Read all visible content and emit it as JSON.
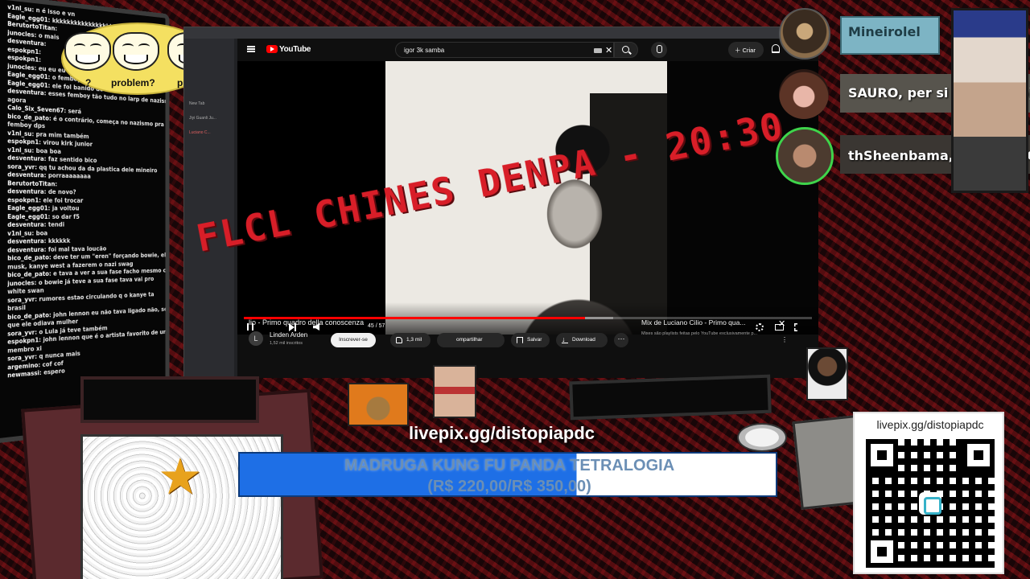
{
  "chat": {
    "lines": [
      {
        "user": "v1nl_su",
        "text": "n é isso e vn"
      },
      {
        "user": "Eagle_egg01",
        "text": "kkkkkkkkkkkkkkkkkkkk"
      },
      {
        "user": "BerutortoTitan",
        "text": ""
      },
      {
        "user": "junocles",
        "text": "o mais"
      },
      {
        "user": "desventura",
        "text": ""
      },
      {
        "user": "espokpn1",
        "text": ""
      },
      {
        "user": "espokpn1",
        "text": ""
      },
      {
        "user": "junocles",
        "text": "eu eu eu"
      },
      {
        "user": "Eagle_egg01",
        "text": "o femboy q quase vazou nuds na dm?"
      },
      {
        "user": "Eagle_egg01",
        "text": "ele fol banido do server"
      },
      {
        "user": "desventura",
        "text": "esses femboy tão tudo no larp de nazismo"
      },
      {
        "user": "",
        "text": "agora"
      },
      {
        "user": "Calo_Six_Seven67",
        "text": "será"
      },
      {
        "user": "bico_de_pato",
        "text": "é o contrário, começa no nazismo pra virar"
      },
      {
        "user": "",
        "text": "femboy dps"
      },
      {
        "user": "v1nl_su",
        "text": "pra mim também"
      },
      {
        "user": "espokpn1",
        "text": "virou kirk junior"
      },
      {
        "user": "v1nl_su",
        "text": "boa boa"
      },
      {
        "user": "desventura",
        "text": "faz sentido bico"
      },
      {
        "user": "sora_yvr",
        "text": "qq tu achou da da plastica dele mineiro"
      },
      {
        "user": "desventura",
        "text": "porraaaaaaaa"
      },
      {
        "user": "BerutortoTitan",
        "text": ""
      },
      {
        "user": "desventura",
        "text": "de novo?"
      },
      {
        "user": "espokpn1",
        "text": "ele foi trocar"
      },
      {
        "user": "Eagle_egg01",
        "text": "ja voltou"
      },
      {
        "user": "Eagle_egg01",
        "text": "so dar f5"
      },
      {
        "user": "desventura",
        "text": "tendi"
      },
      {
        "user": "v1nl_su",
        "text": "boa"
      },
      {
        "user": "desventura",
        "text": "kkkkkk"
      },
      {
        "user": "desventura",
        "text": "foi mal tava loucão"
      },
      {
        "user": "bico_de_pato",
        "text": "deve ter um \"eren\" forçando bowie, elon"
      },
      {
        "user": "",
        "text": "musk, kanye west a fazerem o nazi swag"
      },
      {
        "user": "bico_de_pato",
        "text": "e tava a ver a sua fase facho mesmo como"
      },
      {
        "user": "junocles",
        "text": "o bowie já teve a sua fase tava vai pro"
      },
      {
        "user": "",
        "text": "white swan"
      },
      {
        "user": "sora_yvr",
        "text": "rumores estao circulando q o kanye ta"
      },
      {
        "user": "",
        "text": "brasil"
      },
      {
        "user": "bico_de_pato",
        "text": "john lennon eu não tava ligado não, só sabia"
      },
      {
        "user": "",
        "text": "que ele odiava mulher"
      },
      {
        "user": "sora_yvr",
        "text": "o Lula já teve também"
      },
      {
        "user": "espokpn1",
        "text": "john lennon que é o artista favorito de um ex"
      },
      {
        "user": "",
        "text": "membro xi"
      },
      {
        "user": "sora_yvr",
        "text": "q nunca mais"
      },
      {
        "user": "argemino",
        "text": "cof cof"
      },
      {
        "user": "newmassi",
        "text": "espero"
      }
    ]
  },
  "sticker": {
    "caption_1": "?",
    "caption_2": "problem?",
    "caption_3": "prob"
  },
  "browser": {
    "sidebar_tabs": [
      "New Tab",
      "Jiyi Guanli Ju...",
      "Luciano C..."
    ]
  },
  "youtube": {
    "logo_text": "YouTube",
    "search_query": "igor 3k samba",
    "create_label": "Criar",
    "video_title": "lio - Primo quadro della conoscenza",
    "channel_initial": "L",
    "channel_name": "Linden Arden",
    "channel_subs": "1,52 mil inscritos",
    "subscribe_label": "Inscrever-se",
    "like_count": "1,3 mil",
    "share_label": "ompartilhar",
    "save_label": "Salvar",
    "download_label": "Download",
    "time_label": "45 / 57",
    "progress": 0.6,
    "buffered": 0.65,
    "mix_title": "Mix de Luciano Cilio - Primo qua...",
    "mix_subtitle": "Mixes são playlists feitas pelo YouTube exclusivamente p..."
  },
  "webcams": {
    "names": [
      "Mineirolel",
      "SAURO, per si (formático) pe",
      "thSheenbama, EMISSÁRIO a"
    ]
  },
  "overlay": {
    "marquee": "FLCL CHINES DENPA - 20:30",
    "donation_link": "livepix.gg/distopiapdc",
    "alert_line_1": "MADRUGA KUNG FU PANDA TETRALOGIA",
    "alert_line_2": "(R$ 220,00/R$ 350,00)",
    "alert_progress": 0.6286
  },
  "qr": {
    "label": "livepix.gg/distopiapdc"
  },
  "colors": {
    "accent_red": "#d81e28",
    "youtube_red": "#ff0000",
    "alert_blue": "#1e6fe6",
    "cam_active_green": "#3fd44b"
  }
}
